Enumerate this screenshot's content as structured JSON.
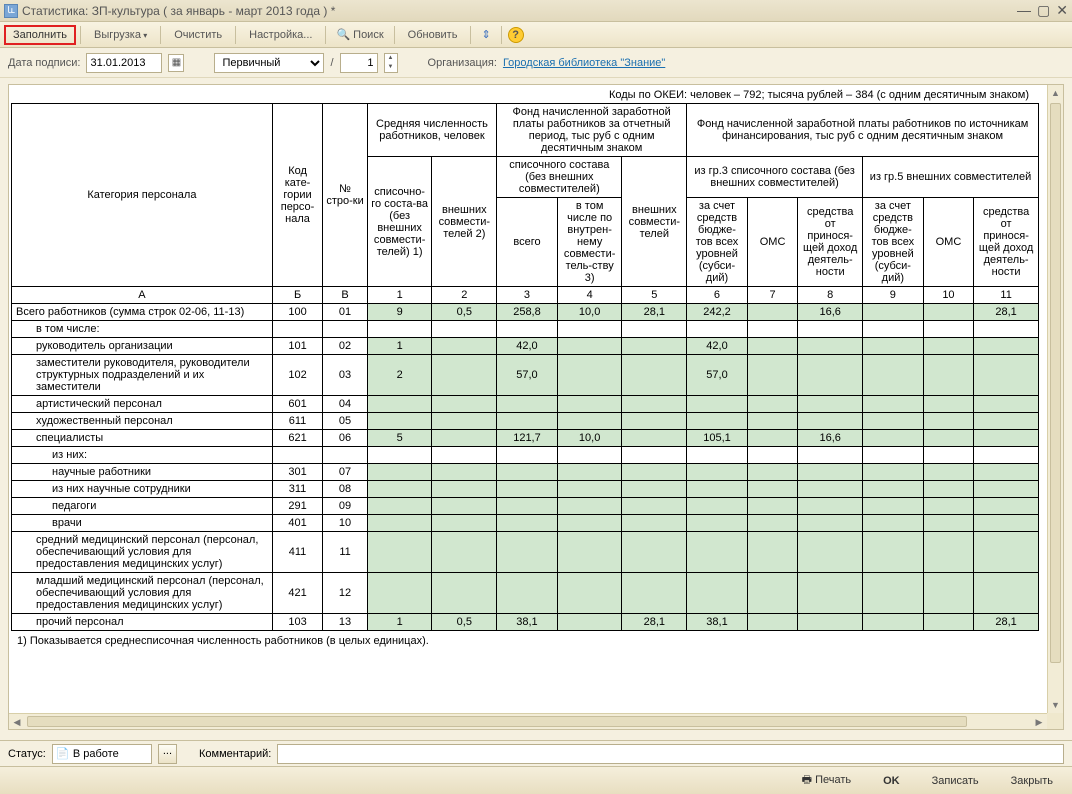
{
  "window": {
    "title": "Статистика: ЗП-культура ( за январь - март 2013 года ) *"
  },
  "toolbar": {
    "fill": "Заполнить",
    "export": "Выгрузка",
    "clear": "Очистить",
    "settings": "Настройка...",
    "search": "Поиск",
    "refresh": "Обновить"
  },
  "params": {
    "date_label": "Дата подписи:",
    "date_value": "31.01.2013",
    "type_value": "Первичный",
    "slash": "/",
    "num_value": "1",
    "org_label": "Организация:",
    "org_value": "Городская библиотека \"Знание\""
  },
  "okei": "Коды по ОКЕИ: человек – 792; тысяча рублей – 384 (с одним десятичным знаком)",
  "headers": {
    "cat": "Категория персонала",
    "code": "Код кате-гории персо-нала",
    "rownum": "№ стро-ки",
    "avg": "Средняя численность работников, человек",
    "fund_period": "Фонд начисленной заработной платы работников за отчетный период, тыс руб с одним десятичным знаком",
    "fund_src": "Фонд начисленной заработной платы работников по источникам финансирования, тыс руб с одним десятичным знаком",
    "list": "списочно-го соста-ва (без внешних совмести-телей) 1)",
    "ext": "внешних совмести-телей 2)",
    "list2_top": "списочного состава (без внешних совместителей)",
    "ext2": "внешних совмести-телей",
    "total": "всего",
    "incl": "в том числе по внутрен-нему совмести-тель-ству 3)",
    "g3": "из гр.3 списочного состава (без внешних совместителей)",
    "g5": "из гр.5 внешних совместителей",
    "budget": "за счет средств бюдже-тов всех уровней (субси-дий)",
    "oms": "ОМС",
    "income": "средства от принося-щей доход деятель-ности",
    "col_a": "А",
    "col_b": "Б",
    "col_v": "В",
    "c1": "1",
    "c2": "2",
    "c3": "3",
    "c4": "4",
    "c5": "5",
    "c6": "6",
    "c7": "7",
    "c8": "8",
    "c9": "9",
    "c10": "10",
    "c11": "11"
  },
  "rows": [
    {
      "label": "Всего работников\n(сумма строк 02-06, 11-13)",
      "ind": 0,
      "code": "100",
      "num": "01",
      "v": [
        "9",
        "0,5",
        "258,8",
        "10,0",
        "28,1",
        "242,2",
        "",
        "16,6",
        "",
        "",
        "28,1"
      ],
      "g": [
        1,
        1,
        1,
        1,
        1,
        1,
        1,
        1,
        1,
        1,
        1
      ]
    },
    {
      "label": "в том числе:",
      "ind": 1,
      "code": "",
      "num": "",
      "v": [
        "",
        "",
        "",
        "",
        "",
        "",
        "",
        "",
        "",
        "",
        ""
      ]
    },
    {
      "label": "руководитель организации",
      "ind": 1,
      "code": "101",
      "num": "02",
      "v": [
        "1",
        "",
        "42,0",
        "",
        "",
        "42,0",
        "",
        "",
        "",
        "",
        ""
      ],
      "g": [
        1,
        1,
        1,
        1,
        1,
        1,
        1,
        1,
        1,
        1,
        1
      ]
    },
    {
      "label": "заместители руководителя, руководители структурных подразделений и их заместители",
      "ind": 1,
      "code": "102",
      "num": "03",
      "v": [
        "2",
        "",
        "57,0",
        "",
        "",
        "57,0",
        "",
        "",
        "",
        "",
        ""
      ],
      "g": [
        1,
        1,
        1,
        1,
        1,
        1,
        1,
        1,
        1,
        1,
        1
      ]
    },
    {
      "label": "артистический персонал",
      "ind": 1,
      "code": "601",
      "num": "04",
      "v": [
        "",
        "",
        "",
        "",
        "",
        "",
        "",
        "",
        "",
        "",
        ""
      ],
      "g": [
        1,
        1,
        1,
        1,
        1,
        1,
        1,
        1,
        1,
        1,
        1
      ]
    },
    {
      "label": "художественный персонал",
      "ind": 1,
      "code": "611",
      "num": "05",
      "v": [
        "",
        "",
        "",
        "",
        "",
        "",
        "",
        "",
        "",
        "",
        ""
      ],
      "g": [
        1,
        1,
        1,
        1,
        1,
        1,
        1,
        1,
        1,
        1,
        1
      ]
    },
    {
      "label": "специалисты",
      "ind": 1,
      "code": "621",
      "num": "06",
      "v": [
        "5",
        "",
        "121,7",
        "10,0",
        "",
        "105,1",
        "",
        "16,6",
        "",
        "",
        ""
      ],
      "g": [
        1,
        1,
        1,
        1,
        1,
        1,
        1,
        1,
        1,
        1,
        1
      ]
    },
    {
      "label": "из них:",
      "ind": 2,
      "code": "",
      "num": "",
      "v": [
        "",
        "",
        "",
        "",
        "",
        "",
        "",
        "",
        "",
        "",
        ""
      ]
    },
    {
      "label": "научные работники",
      "ind": 2,
      "code": "301",
      "num": "07",
      "v": [
        "",
        "",
        "",
        "",
        "",
        "",
        "",
        "",
        "",
        "",
        ""
      ],
      "g": [
        1,
        1,
        1,
        1,
        1,
        1,
        1,
        1,
        1,
        1,
        1
      ]
    },
    {
      "label": "из них научные сотрудники",
      "ind": 2,
      "code": "311",
      "num": "08",
      "v": [
        "",
        "",
        "",
        "",
        "",
        "",
        "",
        "",
        "",
        "",
        ""
      ],
      "g": [
        1,
        1,
        1,
        1,
        1,
        1,
        1,
        1,
        1,
        1,
        1
      ]
    },
    {
      "label": "педагоги",
      "ind": 2,
      "code": "291",
      "num": "09",
      "v": [
        "",
        "",
        "",
        "",
        "",
        "",
        "",
        "",
        "",
        "",
        ""
      ],
      "g": [
        1,
        1,
        1,
        1,
        1,
        1,
        1,
        1,
        1,
        1,
        1
      ]
    },
    {
      "label": "врачи",
      "ind": 2,
      "code": "401",
      "num": "10",
      "v": [
        "",
        "",
        "",
        "",
        "",
        "",
        "",
        "",
        "",
        "",
        ""
      ],
      "g": [
        1,
        1,
        1,
        1,
        1,
        1,
        1,
        1,
        1,
        1,
        1
      ]
    },
    {
      "label": "средний медицинский персонал (персонал, обеспечивающий условия для предоставления медицинских услуг)",
      "ind": 1,
      "code": "411",
      "num": "11",
      "v": [
        "",
        "",
        "",
        "",
        "",
        "",
        "",
        "",
        "",
        "",
        ""
      ],
      "g": [
        1,
        1,
        1,
        1,
        1,
        1,
        1,
        1,
        1,
        1,
        1
      ]
    },
    {
      "label": "младший медицинский персонал (персонал, обеспечивающий условия для предоставления медицинских услуг)",
      "ind": 1,
      "code": "421",
      "num": "12",
      "v": [
        "",
        "",
        "",
        "",
        "",
        "",
        "",
        "",
        "",
        "",
        ""
      ],
      "g": [
        1,
        1,
        1,
        1,
        1,
        1,
        1,
        1,
        1,
        1,
        1
      ]
    },
    {
      "label": "прочий персонал",
      "ind": 1,
      "code": "103",
      "num": "13",
      "v": [
        "1",
        "0,5",
        "38,1",
        "",
        "28,1",
        "38,1",
        "",
        "",
        "",
        "",
        "28,1"
      ],
      "g": [
        1,
        1,
        1,
        1,
        1,
        1,
        1,
        1,
        1,
        1,
        1
      ]
    }
  ],
  "footnote": "1) Показывается среднесписочная численность работников (в целых единицах).",
  "status": {
    "label": "Статус:",
    "value": "В работе",
    "comment_label": "Комментарий:",
    "comment_value": ""
  },
  "bottom": {
    "print": "Печать",
    "ok": "OK",
    "save": "Записать",
    "close": "Закрыть"
  }
}
